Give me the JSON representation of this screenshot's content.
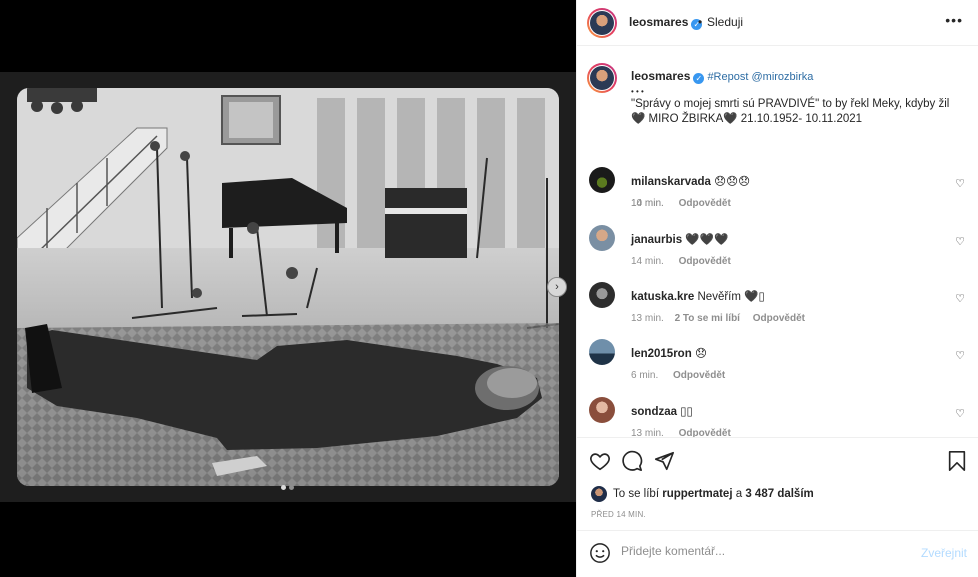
{
  "post": {
    "username": "leosmares",
    "follow_label": "Sleduji",
    "header_dot": "•",
    "caption": {
      "hashtag": "#Repost",
      "mention": "@mirozbirka",
      "ellipsis": "• • •",
      "text": "\"Správy o mojej smrti sú PRAVDIVÉ\" to by řekl Meky, kdyby žil 🖤 MIRO ŽBIRKA🖤 21.10.1952- 10.11.2021",
      "time": "14 min."
    },
    "media": {
      "next_arrow": "›",
      "slides": 2,
      "active_slide": 1
    }
  },
  "comments": [
    {
      "user": "milanskarvada",
      "text": "😞😞😞",
      "time": "10 min.",
      "likes_label": "",
      "reply": "Odpovědět",
      "avatar_color": "#1a1a1a"
    },
    {
      "user": "janaurbis",
      "text": "🖤🖤🖤",
      "time": "14 min.",
      "likes_label": "",
      "reply": "Odpovědět",
      "avatar_color": "#7a8fa3"
    },
    {
      "user": "katuska.kre",
      "text": "Nevěřím 🖤▯",
      "time": "13 min.",
      "likes_label": "2 To se mi líbí",
      "reply": "Odpovědět",
      "avatar_color": "#3a3a3a"
    },
    {
      "user": "len2015ron",
      "text": "😞",
      "time": "6 min.",
      "likes_label": "",
      "reply": "Odpovědět",
      "avatar_color": "#2f4a63"
    },
    {
      "user": "sondzaa",
      "text": "▯▯",
      "time": "13 min.",
      "likes_label": "",
      "reply": "Odpovědět",
      "avatar_color": "#c98a78"
    }
  ],
  "likes": {
    "prefix": "To se líbí",
    "user": "ruppertmatej",
    "connector": "a",
    "others": "3 487 dalším"
  },
  "posted_ago": "PŘED 14 MIN.",
  "comment_box": {
    "placeholder": "Přidejte komentář...",
    "post_label": "Zveřejnit"
  },
  "icons": {
    "like": "heart-outline-icon",
    "comment": "speech-bubble-icon",
    "share": "paper-plane-icon",
    "save": "bookmark-icon",
    "emoji": "smiley-icon",
    "more": "ellipsis-icon",
    "verified": "verified-badge-icon"
  },
  "colors": {
    "accent_link": "#00376b",
    "post_disabled": "#b3dbff",
    "verified": "#3897f0"
  }
}
